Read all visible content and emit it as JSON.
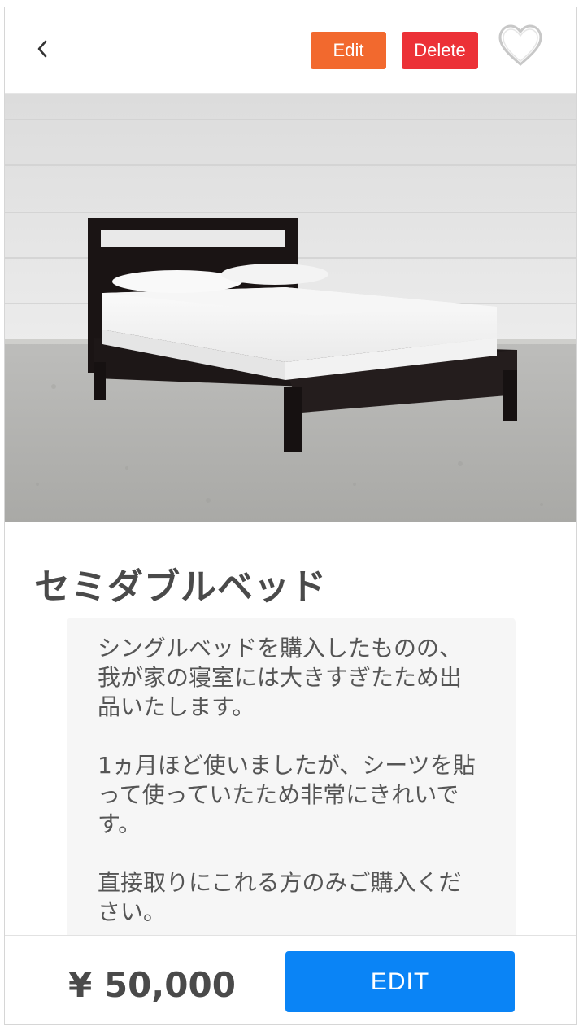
{
  "header": {
    "back_icon": "chevron-left-icon",
    "edit_label": "Edit",
    "delete_label": "Delete",
    "favorite_icon": "heart-outline-icon",
    "colors": {
      "edit": "#f2692e",
      "delete": "#ec3137"
    }
  },
  "product": {
    "image_icon": "bed-product-photo",
    "title": "セミダブルベッド",
    "description": [
      "シングルベッドを購入したものの、我が家の寝室には大きすぎたため出品いたします。",
      "1ヵ月ほど使いましたが、シーツを貼って使っていたため非常にきれいです。",
      "直接取りにこれる方のみご購入ください。"
    ]
  },
  "footer": {
    "price": "¥ 50,000",
    "edit_button_label": "EDIT",
    "colors": {
      "edit_button": "#0a84f6"
    }
  }
}
